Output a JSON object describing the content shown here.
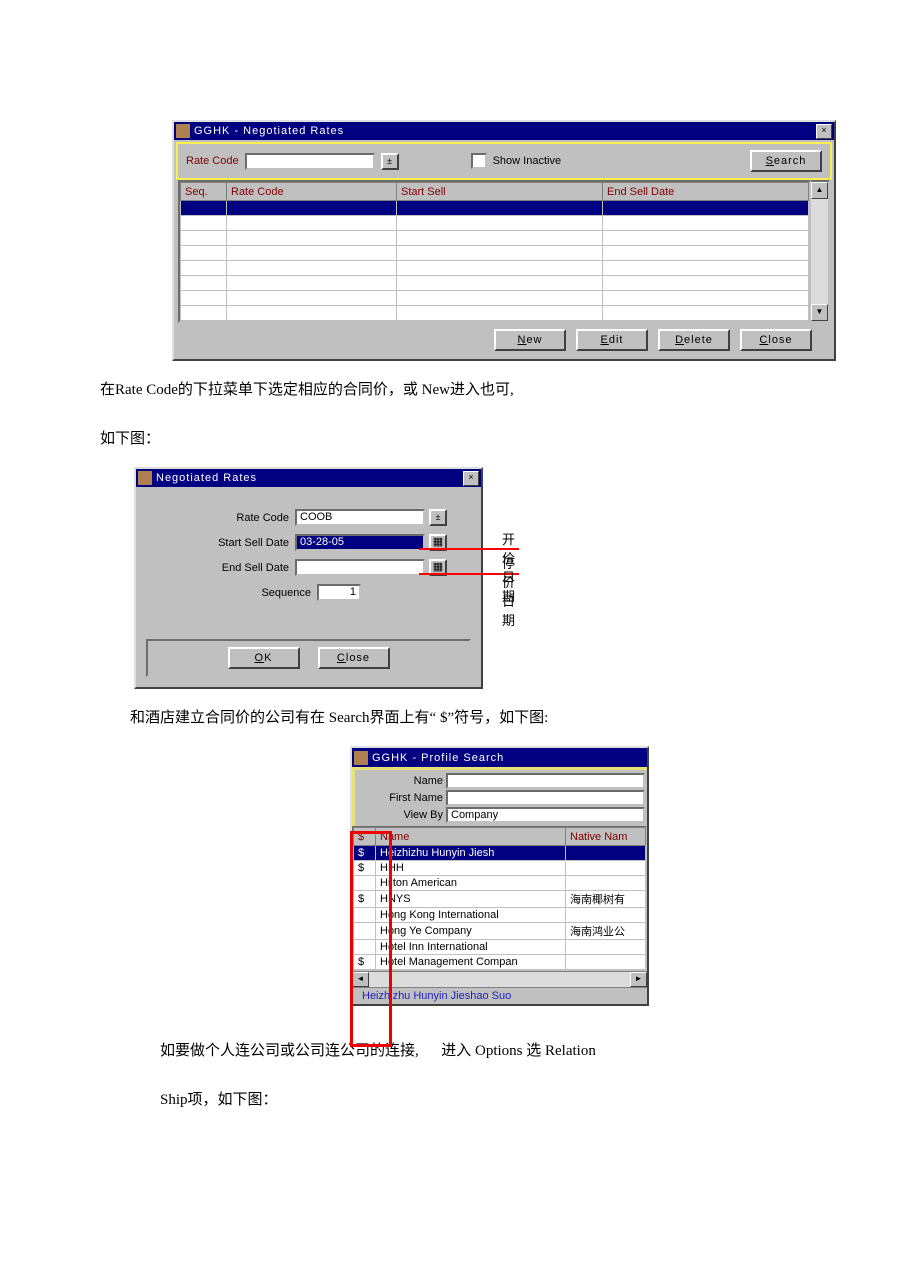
{
  "win1": {
    "title": "GGHK - Negotiated Rates",
    "rate_code_label": "Rate Code",
    "show_inactive_label": "Show Inactive",
    "search_btn": "Search",
    "cols": {
      "seq": "Seq.",
      "rate_code": "Rate Code",
      "start": "Start Sell",
      "end": "End Sell Date"
    },
    "buttons": {
      "new": "New",
      "edit": "Edit",
      "delete": "Delete",
      "close": "Close"
    }
  },
  "para1": "在Rate Code的下拉菜单下选定相应的合同价，或 New进入也可,",
  "para2": "如下图：",
  "win2": {
    "title": "Negotiated Rates",
    "fields": {
      "rate_code_label": "Rate Code",
      "rate_code_value": "COOB",
      "start_label": "Start Sell Date",
      "start_value": "03-28-05",
      "end_label": "End Sell Date",
      "end_value": "",
      "seq_label": "Sequence",
      "seq_value": "1"
    },
    "buttons": {
      "ok": "OK",
      "close": "Close"
    },
    "annotations": {
      "start": "开价日期",
      "end": "停价日期"
    }
  },
  "para3": "和酒店建立合同价的公司有在 Search界面上有“ $”符号，如下图:",
  "win3": {
    "title": "GGHK - Profile Search",
    "fields": {
      "name_label": "Name",
      "first_name_label": "First Name",
      "view_by_label": "View By",
      "view_by_value": "Company"
    },
    "cols": {
      "dollar": "$",
      "name": "Name",
      "native": "Native Nam"
    },
    "rows": [
      {
        "d": "$",
        "name": "Heizhizhu Hunyin Jiesh",
        "native": "",
        "sel": true
      },
      {
        "d": "$",
        "name": "HHH",
        "native": ""
      },
      {
        "d": "",
        "name": "Hilton American",
        "native": ""
      },
      {
        "d": "$",
        "name": "HNYS",
        "native": "海南椰树有"
      },
      {
        "d": "",
        "name": "Hong Kong International",
        "native": ""
      },
      {
        "d": "",
        "name": "Hong Ye Company",
        "native": "海南鸿业公"
      },
      {
        "d": "",
        "name": "Hotel Inn International",
        "native": ""
      },
      {
        "d": "$",
        "name": "Hotel Management Compan",
        "native": ""
      }
    ],
    "status": "Heizhizhu Hunyin Jieshao Suo"
  },
  "para4": "如要做个人连公司或公司连公司的连接,",
  "para4b": "进入 Options 选 Relation",
  "para5": "Ship项，如下图："
}
